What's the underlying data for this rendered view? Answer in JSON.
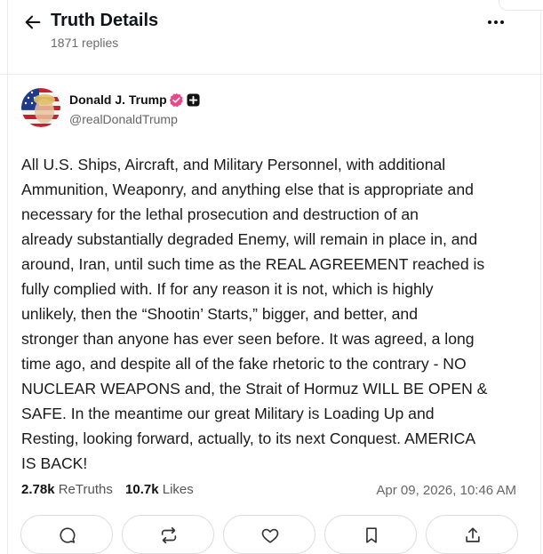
{
  "header": {
    "title": "Truth Details",
    "replies": "1871 replies"
  },
  "author": {
    "name": "Donald J. Trump",
    "handle": "@realDonaldTrump"
  },
  "post": {
    "body": "All U.S. Ships, Aircraft, and Military Personnel, with additional\nAmmunition, Weaponry, and anything else that is appropriate and\nnecessary for the lethal prosecution and destruction of an\nalready substantially degraded Enemy, will remain in place in, and\naround, Iran, until such time as the REAL AGREEMENT reached is\nfully complied with. If for any reason it is not, which is highly\nunlikely, then the “Shootin’ Starts,” bigger, and better, and\nstronger than anyone has ever seen before. It was agreed, a long\ntime ago, and despite all of the fake rhetoric to the contrary - NO\nNUCLEAR WEAPONS and, the Strait of Hormuz WILL BE OPEN &\nSAFE. In the meantime our great Military is Loading Up and\nResting, looking forward, actually, to its next Conquest. AMERICA\nIS BACK!",
    "retruths_count": "2.78k",
    "retruths_label": "ReTruths",
    "likes_count": "10.7k",
    "likes_label": "Likes",
    "timestamp": "Apr 09, 2026, 10:46 AM"
  },
  "actions": [
    "reply-icon",
    "retruth-icon",
    "like-icon",
    "bookmark-icon",
    "share-icon"
  ],
  "colors": {
    "verified": "#e8488c",
    "text": "#1a1a1a",
    "muted": "#666666"
  }
}
